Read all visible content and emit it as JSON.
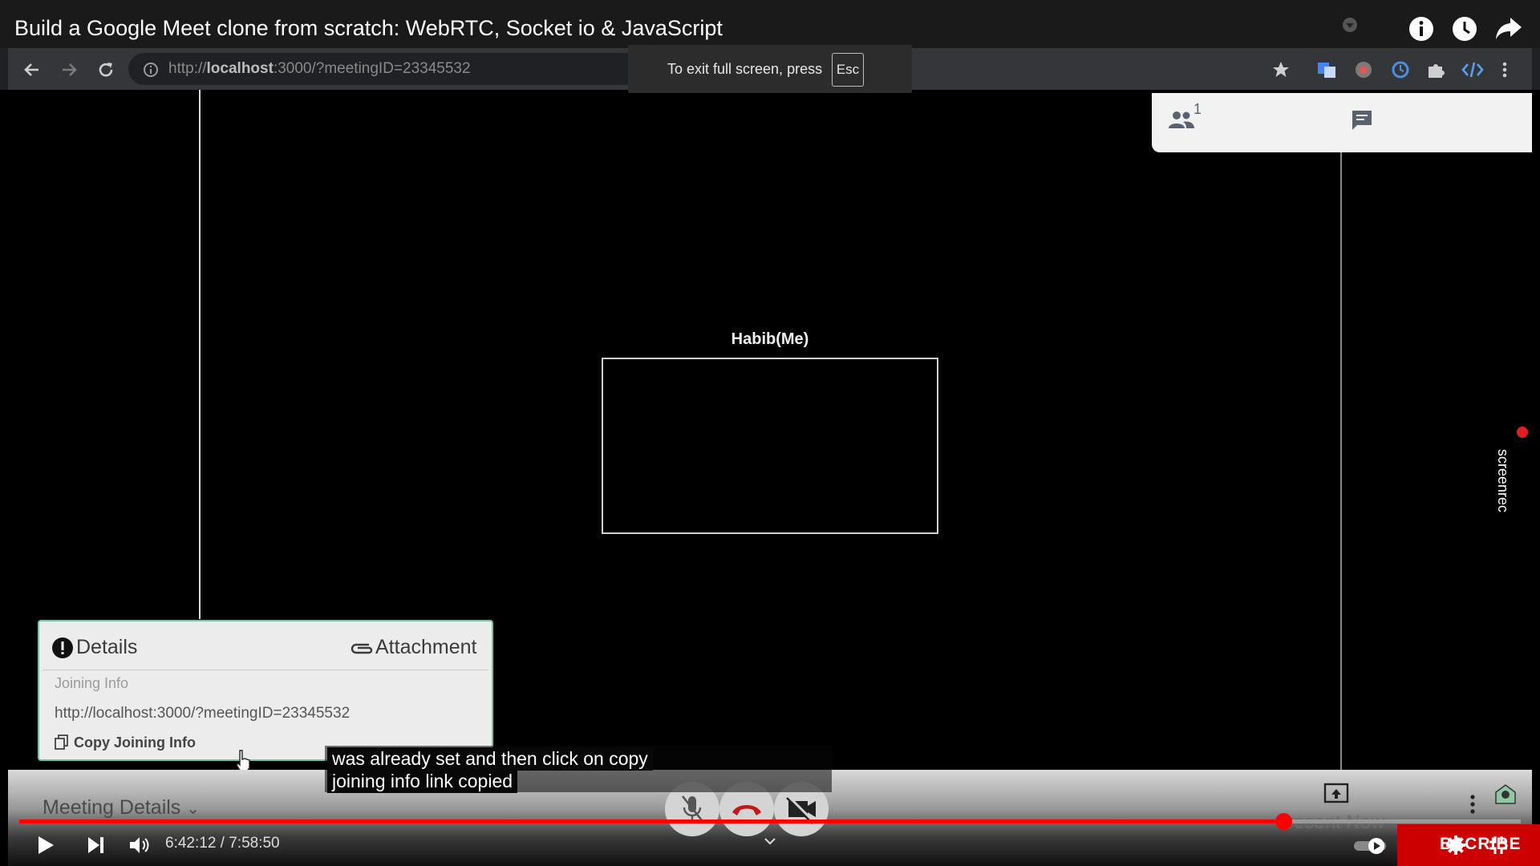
{
  "video": {
    "title": "Build a Google Meet clone from scratch: WebRTC, Socket io & JavaScript",
    "top_icons": [
      "info-icon",
      "watch-later-icon",
      "share-icon"
    ]
  },
  "browser": {
    "url_prefix": "http://",
    "url_host": "localhost",
    "url_rest": ":3000/?meetingID=23345532",
    "toolbar_icons": [
      "back-icon",
      "forward-icon",
      "reload-icon",
      "info-icon",
      "star-icon",
      "translate-icon",
      "extension-icon",
      "code-icon",
      "menu-icon"
    ]
  },
  "fullscreen_toast": {
    "text": "To exit full screen, press",
    "key": "Esc"
  },
  "meet": {
    "participant_count": "1",
    "tile_name": "Habib(Me)",
    "details_panel": {
      "details_tab": "Details",
      "attachment_tab": "Attachment",
      "joining_info_label": "Joining Info",
      "joining_url": "http://localhost:3000/?meetingID=23345532",
      "copy_label": "Copy Joining Info"
    },
    "bottom_bar": {
      "meeting_details_label": "Meeting Details",
      "present_now_label": "resent Now"
    }
  },
  "captions": {
    "line1": "was already set and then click on copy",
    "line2": "joining info link copied"
  },
  "player": {
    "time": "6:42:12 / 7:58:50",
    "progress": 0.8419,
    "subscribe_label": "BSCRIBE",
    "watermark": "screenrec"
  },
  "colors": {
    "progress": "#ff0000",
    "hangup": "#c21818",
    "details_border": "#76c2a7",
    "subscribe": "#cc0000"
  }
}
